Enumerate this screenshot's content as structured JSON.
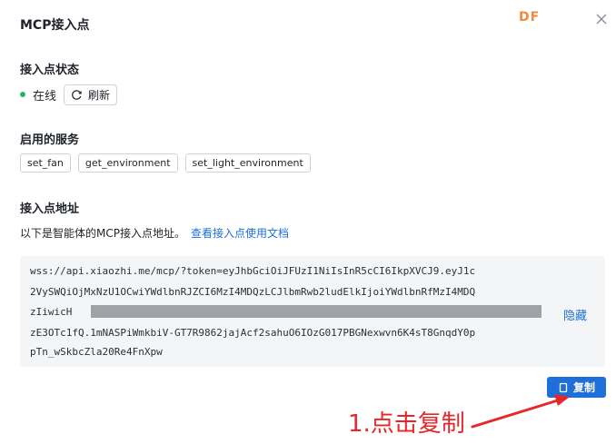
{
  "dialog": {
    "title": "MCP接入点",
    "watermark": "DF"
  },
  "status": {
    "label": "接入点状态",
    "state": "在线",
    "refresh_label": "刷新",
    "state_color": "#21b36d"
  },
  "services": {
    "label": "启用的服务",
    "items": [
      "set_fan",
      "get_environment",
      "set_light_environment"
    ]
  },
  "address": {
    "label": "接入点地址",
    "description": "以下是智能体的MCP接入点地址。",
    "docs_link": "查看接入点使用文档",
    "lines": [
      "wss://api.xiaozhi.me/mcp/?token=eyJhbGciOiJFUzI1NiIsInR5cCI6IkpXVCJ9.eyJ1c",
      "2VySWQiOjMxNzU1OCwiYWdlbnRJZCI6MzI4MDQzLCJlbmRwb2ludElkIjoiYWdlbnRfMzI4MDQ",
      "zIiwicH",
      "zE3OTc1fQ.1mNASPiWmkbiV-GT7R9862jajAcf2sahuO6IOzG017PBGNexwvn6K4sT8GnqdY0p",
      "pTn_wSkbcZla20Re4FnXpw"
    ],
    "hide_label": "隐藏",
    "copy_label": "复制"
  },
  "annotation": {
    "text": "1.点击复制",
    "color": "#e8262a"
  },
  "colors": {
    "accent": "#1e6fd9",
    "code_bg": "#f4f5f7"
  }
}
